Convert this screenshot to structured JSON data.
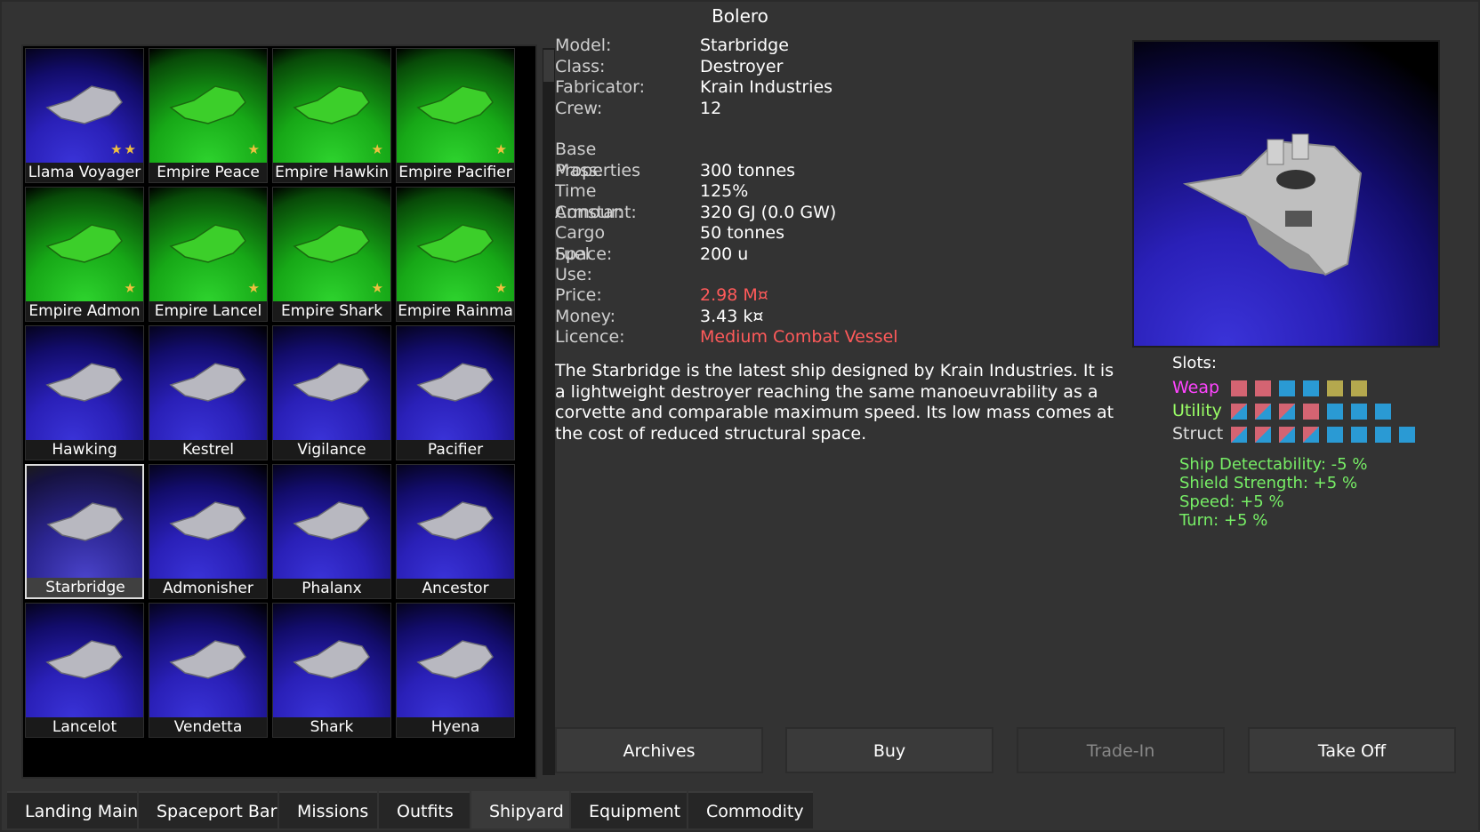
{
  "window": {
    "title": "Bolero"
  },
  "ships": [
    {
      "name": "Llama Voyager",
      "stars": "★★",
      "bg": "blue"
    },
    {
      "name": "Empire Peace",
      "stars": "★",
      "bg": "green"
    },
    {
      "name": "Empire Hawkin",
      "stars": "★",
      "bg": "green"
    },
    {
      "name": "Empire Pacifier",
      "stars": "★",
      "bg": "green"
    },
    {
      "name": "Empire Admon",
      "stars": "★",
      "bg": "green"
    },
    {
      "name": "Empire Lancel",
      "stars": "★",
      "bg": "green"
    },
    {
      "name": "Empire Shark",
      "stars": "★",
      "bg": "green"
    },
    {
      "name": "Empire Rainma",
      "stars": "★",
      "bg": "green"
    },
    {
      "name": "Hawking",
      "stars": "",
      "bg": "blue"
    },
    {
      "name": "Kestrel",
      "stars": "",
      "bg": "blue"
    },
    {
      "name": "Vigilance",
      "stars": "",
      "bg": "blue"
    },
    {
      "name": "Pacifier",
      "stars": "",
      "bg": "blue"
    },
    {
      "name": "Starbridge",
      "stars": "",
      "bg": "blue",
      "selected": true
    },
    {
      "name": "Admonisher",
      "stars": "",
      "bg": "blue"
    },
    {
      "name": "Phalanx",
      "stars": "",
      "bg": "blue"
    },
    {
      "name": "Ancestor",
      "stars": "",
      "bg": "blue"
    },
    {
      "name": "Lancelot",
      "stars": "",
      "bg": "blue"
    },
    {
      "name": "Vendetta",
      "stars": "",
      "bg": "blue"
    },
    {
      "name": "Shark",
      "stars": "",
      "bg": "blue"
    },
    {
      "name": "Hyena",
      "stars": "",
      "bg": "blue"
    }
  ],
  "info": {
    "model_k": "Model:",
    "model_v": "Starbridge",
    "class_k": "Class:",
    "class_v": "Destroyer",
    "fab_k": "Fabricator:",
    "fab_v": "Krain Industries",
    "crew_k": "Crew:",
    "crew_v": "12",
    "base_title": "Base Properties",
    "mass_k": "Mass:",
    "mass_v": "300 tonnes",
    "tc_k": "Time Constant:",
    "tc_v": "125%",
    "armour_k": "Armour:",
    "armour_v": "320 GJ (0.0 GW)",
    "cargo_k": "Cargo Space:",
    "cargo_v": "50 tonnes",
    "fuel_k": "Fuel Use:",
    "fuel_v": "200 u",
    "price_k": "Price:",
    "price_v": "2.98 M¤",
    "money_k": "Money:",
    "money_v": "3.43 k¤",
    "licence_k": "Licence:",
    "licence_v": "Medium Combat Vessel"
  },
  "description": "The Starbridge is the latest ship designed by Krain Industries. It is a lightweight destroyer reaching the same manoeuvrability as a corvette and comparable maximum speed. Its low mass comes at the cost of reduced structural space.",
  "slots": {
    "title": "Slots:",
    "weap_label": "Weap",
    "utility_label": "Utility",
    "struct_label": "Struct",
    "colors": {
      "weap": "#ff44ff",
      "utility": "#9aff66",
      "struct": "#dddddd"
    }
  },
  "bonuses": {
    "b1": "Ship Detectability: -5 %",
    "b2": "Shield Strength: +5 %",
    "b3": "Speed: +5 %",
    "b4": "Turn: +5 %"
  },
  "buttons": {
    "archives": "Archives",
    "buy": "Buy",
    "tradein": "Trade-In",
    "takeoff": "Take Off"
  },
  "tabs": {
    "landing": "Landing Main",
    "bar": "Spaceport Bar",
    "bar_alert": "!!",
    "missions": "Missions",
    "outfits": "Outfits",
    "shipyard": "Shipyard",
    "equipment": "Equipment",
    "commodity": "Commodity"
  }
}
